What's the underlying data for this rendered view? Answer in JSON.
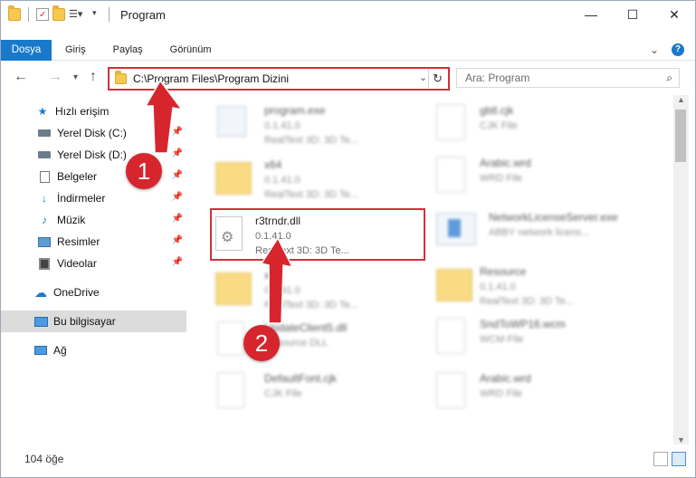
{
  "window": {
    "title": "Program"
  },
  "ribbon": {
    "tabs": [
      "Dosya",
      "Giriş",
      "Paylaş",
      "Görünüm"
    ]
  },
  "address": {
    "path": "C:\\Program Files\\Program Dizini"
  },
  "search": {
    "placeholder": "Ara: Program"
  },
  "sidebar": {
    "items": [
      {
        "label": "Hızlı erişim",
        "icon": "star-icon",
        "pinned": false
      },
      {
        "label": "Yerel Disk (C:)",
        "icon": "drive-icon",
        "pinned": true
      },
      {
        "label": "Yerel Disk (D:)",
        "icon": "drive-icon",
        "pinned": true
      },
      {
        "label": "Belgeler",
        "icon": "documents-icon",
        "pinned": true
      },
      {
        "label": "İndirmeler",
        "icon": "download-icon",
        "pinned": true
      },
      {
        "label": "Müzik",
        "icon": "music-icon",
        "pinned": true
      },
      {
        "label": "Resimler",
        "icon": "pictures-icon",
        "pinned": true
      },
      {
        "label": "Videolar",
        "icon": "videos-icon",
        "pinned": true
      },
      {
        "label": "OneDrive",
        "icon": "cloud-icon",
        "pinned": false
      },
      {
        "label": "Bu bilgisayar",
        "icon": "computer-icon",
        "pinned": false,
        "selected": true
      },
      {
        "label": "Ağ",
        "icon": "network-icon",
        "pinned": false
      }
    ]
  },
  "files": {
    "left": [
      {
        "name": "program.exe",
        "meta1": "0.1.41.0",
        "meta2": "RealText 3D:  3D Te...",
        "type": "exe"
      },
      {
        "name": "x64",
        "meta1": "0.1.41.0",
        "meta2": "RealText 3D:  3D Te...",
        "type": "folder"
      },
      {
        "name": "r3trndr.dll",
        "meta1": "0.1.41.0",
        "meta2": "RealText 3D:  3D Te...",
        "type": "dll"
      },
      {
        "name": "x86",
        "meta1": "0.1.41.0",
        "meta2": "RealText 3D:  3D Te...",
        "type": "folder"
      },
      {
        "name": "UpdateClient5.dll",
        "meta1": "Resource DLL",
        "meta2": "",
        "type": "dll"
      },
      {
        "name": "DefaultFont.cjk",
        "meta1": "CJK File",
        "meta2": "",
        "type": "doc"
      }
    ],
    "right": [
      {
        "name": "gbtl.cjk",
        "meta1": "CJK File",
        "type": "doc"
      },
      {
        "name": "Arabic.wrd",
        "meta1": "WRD File",
        "type": "doc"
      },
      {
        "name": "NetworkLicenseServer.exe",
        "meta1": "ABBY network licens...",
        "type": "exe"
      },
      {
        "name": "Resource",
        "meta1": "0.1.41.0",
        "meta2": "RealText 3D:  3D Te...",
        "type": "folder"
      },
      {
        "name": "SndToWP16.wcm",
        "meta1": "WCM File",
        "type": "doc"
      },
      {
        "name": "Arabic.wrd",
        "meta1": "WRD File",
        "type": "doc"
      }
    ]
  },
  "status": {
    "count": "104 öğe"
  },
  "callouts": {
    "one": "1",
    "two": "2"
  },
  "colors": {
    "accent": "#1979ca",
    "highlight": "#d2303a",
    "callout": "#d7252e"
  }
}
